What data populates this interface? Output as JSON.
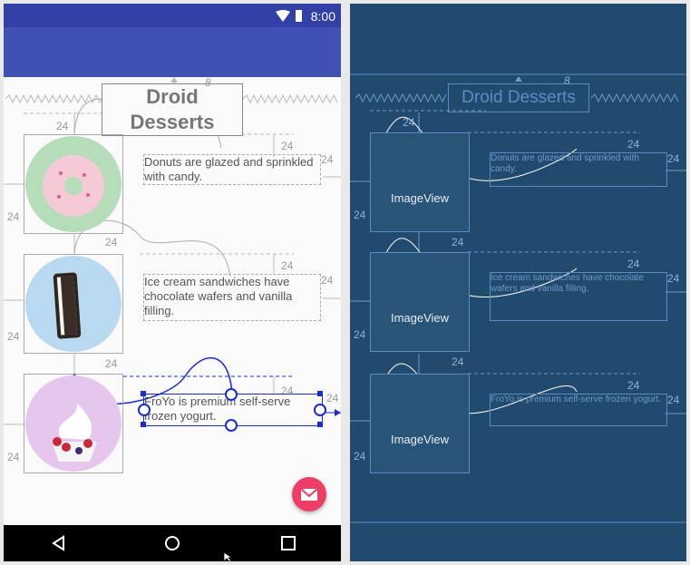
{
  "design": {
    "status_time": "8:00",
    "title": "Droid Desserts",
    "margin_label": "24",
    "margin_top_label": "8",
    "items": [
      {
        "name": "donut",
        "description": "Donuts are glazed and sprinkled with candy."
      },
      {
        "name": "ice-cream-sandwich",
        "description": "Ice cream sandwiches have chocolate wafers and vanilla filling."
      },
      {
        "name": "froyo",
        "description": "FroYo is premium self-serve frozen yogurt."
      }
    ],
    "fab_icon": "email-icon",
    "nav": [
      "back-icon",
      "home-icon",
      "recents-icon"
    ]
  },
  "blueprint": {
    "title": "Droid Desserts",
    "image_label": "ImageView",
    "margin_label": "24",
    "margin_top_label": "8",
    "descriptions": [
      "Donuts are glazed and sprinkled with candy.",
      "Ice cream sandwiches have chocolate wafers and vanilla filling.",
      "FroYo is premium self-serve frozen yogurt."
    ]
  },
  "colors": {
    "primary": "#3f51b5",
    "primary_dark": "#3340a6",
    "accent": "#ee3d66",
    "blueprint_bg": "#214a6f",
    "selection": "#1a2bd6"
  }
}
